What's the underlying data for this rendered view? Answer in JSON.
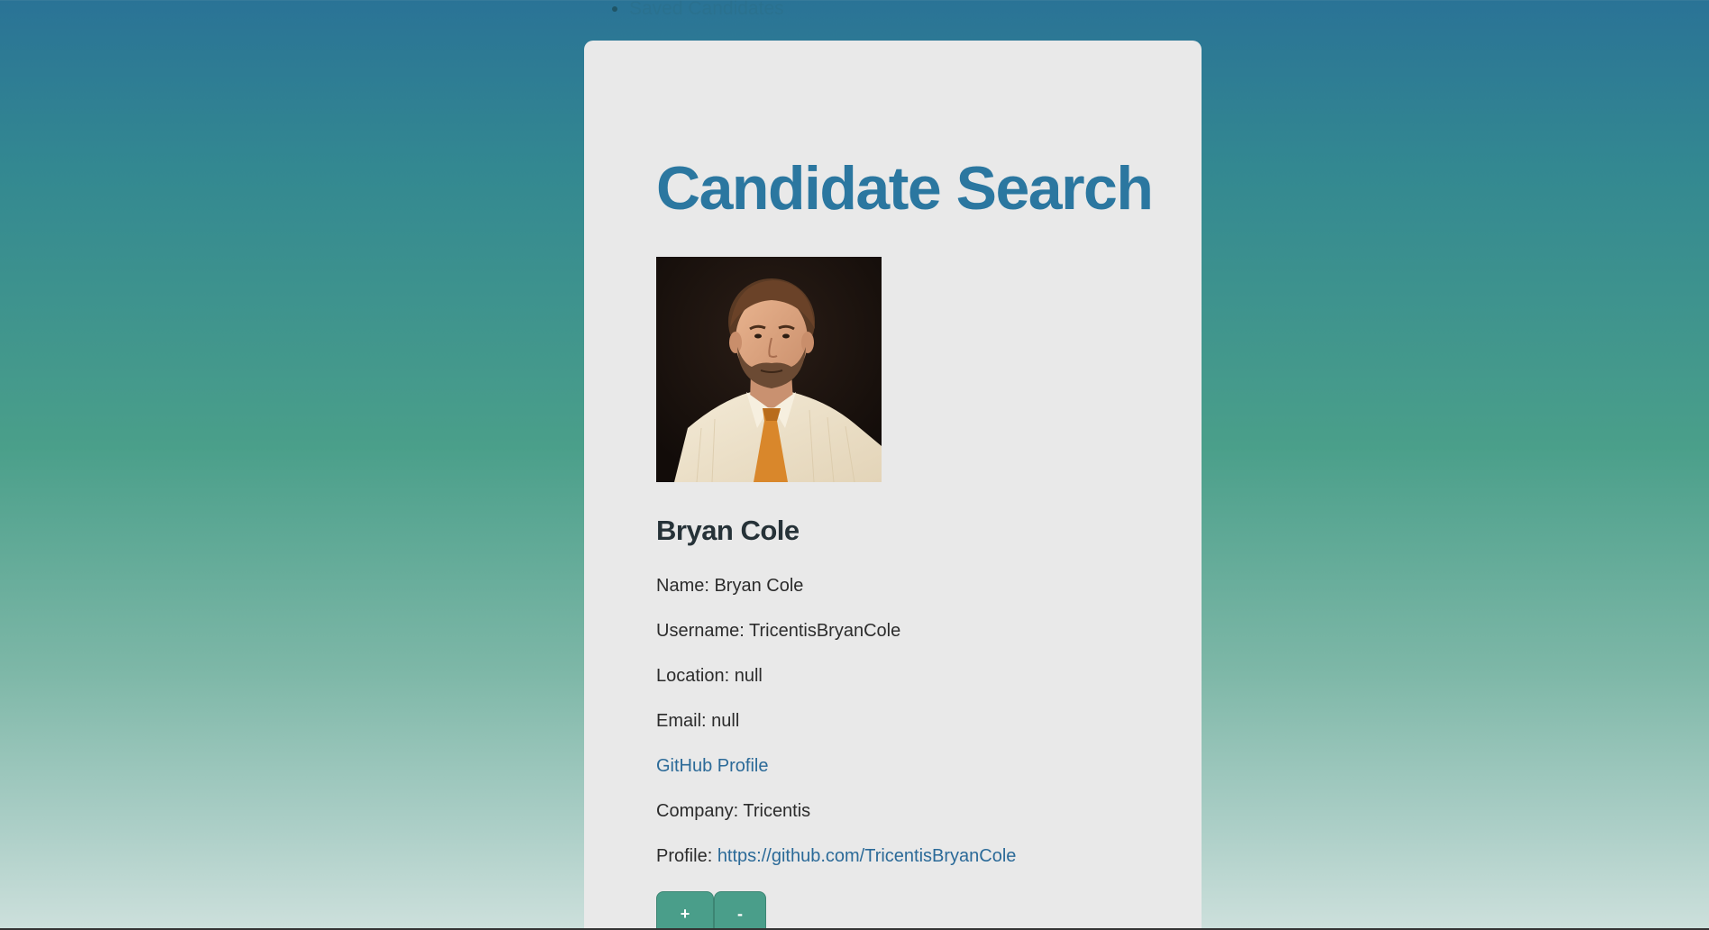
{
  "nav": {
    "items": [
      "Saved Candidates"
    ]
  },
  "page": {
    "title": "Candidate Search"
  },
  "candidate": {
    "avatar_alt": "Bryan Cole avatar",
    "heading": "Bryan Cole",
    "name_label": "Name:",
    "name": "Bryan Cole",
    "username_label": "Username:",
    "username": "TricentisBryanCole",
    "location_label": "Location:",
    "location": "null",
    "email_label": "Email:",
    "email": "null",
    "github_link": "GitHub Profile",
    "company_label": "Company:",
    "company": "Tricentis",
    "profile_label": "Profile:",
    "profile_url": "https://github.com/TricentisBryanCole"
  },
  "actions": {
    "add_label": "+",
    "remove_label": "-"
  },
  "colors": {
    "title": "#2b77a0",
    "button": "#4a9e8a",
    "link": "#2b6a98",
    "card": "#e9e9e9"
  }
}
